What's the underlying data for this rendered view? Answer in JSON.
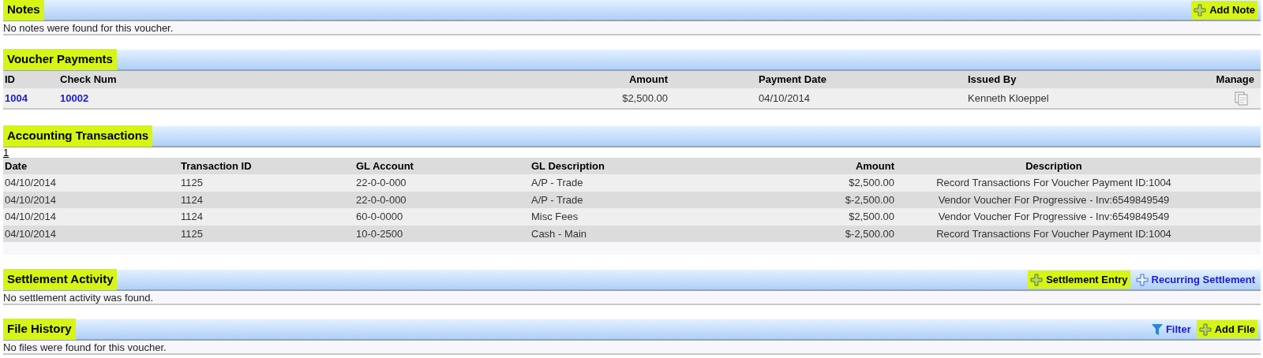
{
  "sections": [
    {
      "kind": "message",
      "title": "Notes",
      "highlighted": true,
      "actions": [
        {
          "label": "Add Note",
          "kind": "add",
          "highlighted": true
        }
      ],
      "message": "No notes were found for this voucher."
    },
    {
      "kind": "payments",
      "title": "Voucher Payments",
      "highlighted": true,
      "columns": [
        "ID",
        "Check Num",
        "Amount",
        "Payment Date",
        "Issued By",
        "Manage"
      ],
      "rows": [
        {
          "id": "1004",
          "check_num": "10002",
          "amount": "$2,500.00",
          "payment_date": "04/10/2014",
          "issued_by": "Kenneth Kloeppel"
        }
      ]
    },
    {
      "kind": "transactions",
      "title": "Accounting Transactions",
      "highlighted": true,
      "pages": [
        "1"
      ],
      "columns": [
        "Date",
        "Transaction ID",
        "GL Account",
        "GL Description",
        "Amount",
        "Description"
      ],
      "rows": [
        [
          "04/10/2014",
          "1125",
          "22-0-0-000",
          "A/P - Trade",
          "$2,500.00",
          "Record Transactions For Voucher Payment ID:1004"
        ],
        [
          "04/10/2014",
          "1124",
          "22-0-0-000",
          "A/P - Trade",
          "$-2,500.00",
          "Vendor Voucher For Progressive - Inv:6549849549"
        ],
        [
          "04/10/2014",
          "1124",
          "60-0-0000",
          "Misc Fees",
          "$2,500.00",
          "Vendor Voucher For Progressive - Inv:6549849549"
        ],
        [
          "04/10/2014",
          "1125",
          "10-0-2500",
          "Cash - Main",
          "$-2,500.00",
          "Record Transactions For Voucher Payment ID:1004"
        ]
      ]
    },
    {
      "kind": "message",
      "title": "Settlement Activity",
      "highlighted": true,
      "actions": [
        {
          "label": "Settlement Entry",
          "kind": "add",
          "highlighted": true
        },
        {
          "label": "Recurring Settlement",
          "kind": "add-outline",
          "highlighted": false
        }
      ],
      "message": "No settlement activity was found."
    },
    {
      "kind": "message",
      "title": "File History",
      "highlighted": true,
      "actions": [
        {
          "label": "Filter",
          "kind": "filter",
          "highlighted": false
        },
        {
          "label": "Add File",
          "kind": "add",
          "highlighted": true
        }
      ],
      "message": "No files were found for this voucher."
    }
  ]
}
